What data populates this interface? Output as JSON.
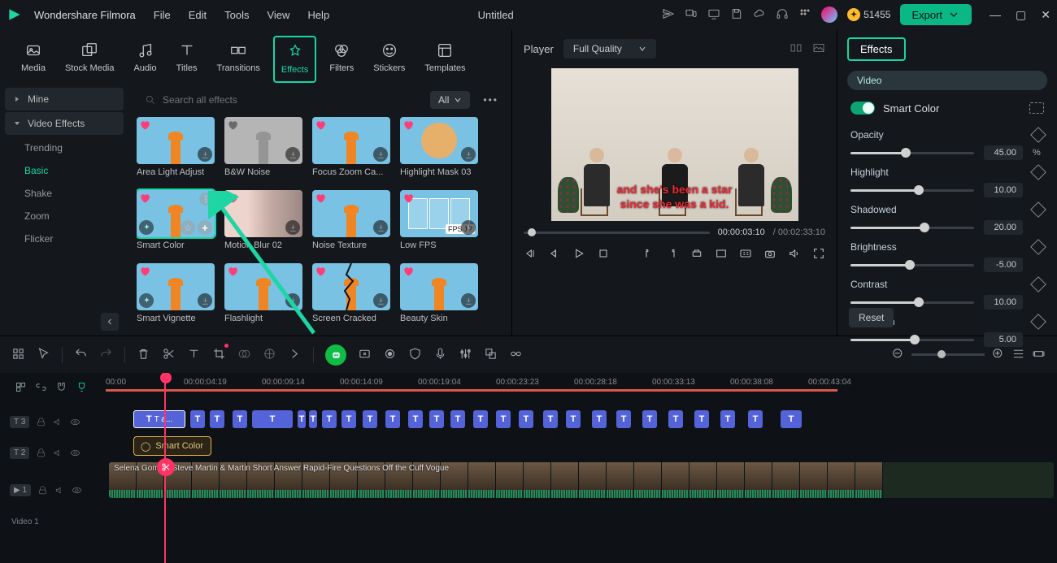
{
  "app": {
    "name": "Wondershare Filmora",
    "document": "Untitled"
  },
  "menubar": [
    "File",
    "Edit",
    "Tools",
    "View",
    "Help"
  ],
  "credits": 51455,
  "export": "Export",
  "tool_tabs": [
    {
      "id": "media",
      "label": "Media"
    },
    {
      "id": "stock-media",
      "label": "Stock Media"
    },
    {
      "id": "audio",
      "label": "Audio"
    },
    {
      "id": "titles",
      "label": "Titles"
    },
    {
      "id": "transitions",
      "label": "Transitions"
    },
    {
      "id": "effects",
      "label": "Effects",
      "active": true
    },
    {
      "id": "filters",
      "label": "Filters"
    },
    {
      "id": "stickers",
      "label": "Stickers"
    },
    {
      "id": "templates",
      "label": "Templates"
    }
  ],
  "sidebar": {
    "mine": "Mine",
    "video_effects": "Video Effects",
    "subs": [
      "Trending",
      "Basic",
      "Shake",
      "Zoom",
      "Flicker"
    ],
    "active_sub": "Basic"
  },
  "search": {
    "placeholder": "Search all effects"
  },
  "filter_all": "All",
  "effects_grid": [
    {
      "id": "area-light-adjust",
      "label": "Area Light Adjust",
      "style": "beacon"
    },
    {
      "id": "bw-noise",
      "label": "B&W Noise",
      "style": "beacon-gray"
    },
    {
      "id": "focus-zoom-camera",
      "label": "Focus Zoom Ca...",
      "style": "beacon"
    },
    {
      "id": "highlight-mask-03",
      "label": "Highlight Mask 03",
      "style": "circle"
    },
    {
      "id": "smart-color",
      "label": "Smart Color",
      "style": "beacon",
      "selected": true,
      "ai": true
    },
    {
      "id": "motion-blur-02",
      "label": "Motion Blur 02",
      "style": "girl"
    },
    {
      "id": "noise-texture",
      "label": "Noise Texture",
      "style": "beacon"
    },
    {
      "id": "low-fps",
      "label": "Low FPS",
      "style": "frames",
      "fps": "FPS 12"
    },
    {
      "id": "smart-vignette",
      "label": "Smart Vignette",
      "style": "beacon",
      "ai": true
    },
    {
      "id": "flashlight",
      "label": "Flashlight",
      "style": "beacon"
    },
    {
      "id": "screen-cracked",
      "label": "Screen Cracked",
      "style": "crack"
    },
    {
      "id": "beauty-skin",
      "label": "Beauty Skin",
      "style": "beacon"
    }
  ],
  "player": {
    "label": "Player",
    "quality": "Full Quality",
    "subtitle1": "and she's been a star",
    "subtitle2": "since she was a kid.",
    "current_time": "00:00:03:10",
    "duration": "00:02:33:10"
  },
  "properties": {
    "tab": "Effects",
    "chip": "Video",
    "toggle_label": "Smart Color",
    "params": [
      {
        "name": "Opacity",
        "value": "45.00",
        "unit": "%",
        "pos": 45
      },
      {
        "name": "Highlight",
        "value": "10.00",
        "unit": "",
        "pos": 55
      },
      {
        "name": "Shadowed",
        "value": "20.00",
        "unit": "",
        "pos": 60
      },
      {
        "name": "Brightness",
        "value": "-5.00",
        "unit": "",
        "pos": 48
      },
      {
        "name": "Contrast",
        "value": "10.00",
        "unit": "",
        "pos": 55
      },
      {
        "name": "Saturation",
        "value": "5.00",
        "unit": "",
        "pos": 52
      }
    ],
    "reset": "Reset"
  },
  "timeline": {
    "ruler": [
      "00:00",
      "00:00:04:19",
      "00:00:09:14",
      "00:00:14:09",
      "00:00:19:04",
      "00:00:23:23",
      "00:00:28:18",
      "00:00:33:13",
      "00:00:38:08",
      "00:00:43:04"
    ],
    "tracks": [
      {
        "id": "t3",
        "badge": "T 3"
      },
      {
        "id": "t2",
        "badge": "T 2"
      },
      {
        "id": "v1",
        "badge": "▶ 1",
        "label": "Video 1"
      }
    ],
    "text_clip_label": "T a...",
    "fx_clip_label": "Smart Color",
    "video_clip_meta": "Selena Gomez, Steve Martin & Martin Short Answer Rapid-Fire Questions   Off the Cuff   Vogue"
  }
}
